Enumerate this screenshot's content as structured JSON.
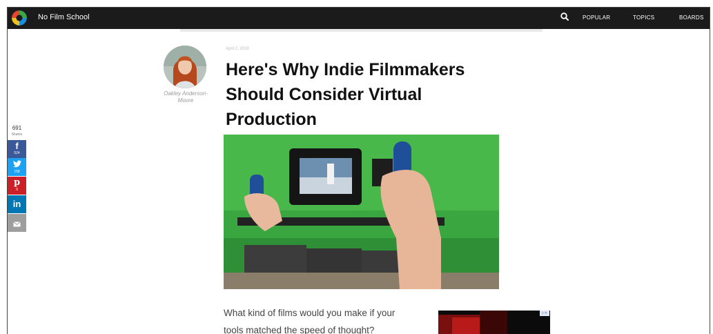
{
  "brand": {
    "site_name": "No Film School"
  },
  "nav": {
    "items": [
      "POPULAR",
      "TOPICS",
      "BOARDS"
    ]
  },
  "article": {
    "date": "April 2, 2018",
    "title": "Here's Why Indie Filmmakers Should Consider Virtual Production",
    "author": "Oakley Anderson-Moore",
    "body_lines": [
      "What kind of films would you make if your",
      "tools matched the speed of thought?"
    ]
  },
  "share": {
    "total": "691",
    "label": "Shares",
    "buttons": [
      {
        "network": "facebook",
        "icon": "f",
        "count": "524"
      },
      {
        "network": "twitter",
        "icon": "twitter-bird",
        "count": "158"
      },
      {
        "network": "pinterest",
        "icon": "p",
        "count": "9"
      },
      {
        "network": "linkedin",
        "icon": "in",
        "count": ""
      },
      {
        "network": "email",
        "icon": "envelope",
        "count": ""
      }
    ]
  },
  "colors": {
    "facebook": "#3b5998",
    "twitter": "#1da1f2",
    "pinterest": "#cb2027",
    "linkedin": "#0077b5",
    "email": "#9e9e9e",
    "navbar": "#1b1b1b"
  }
}
